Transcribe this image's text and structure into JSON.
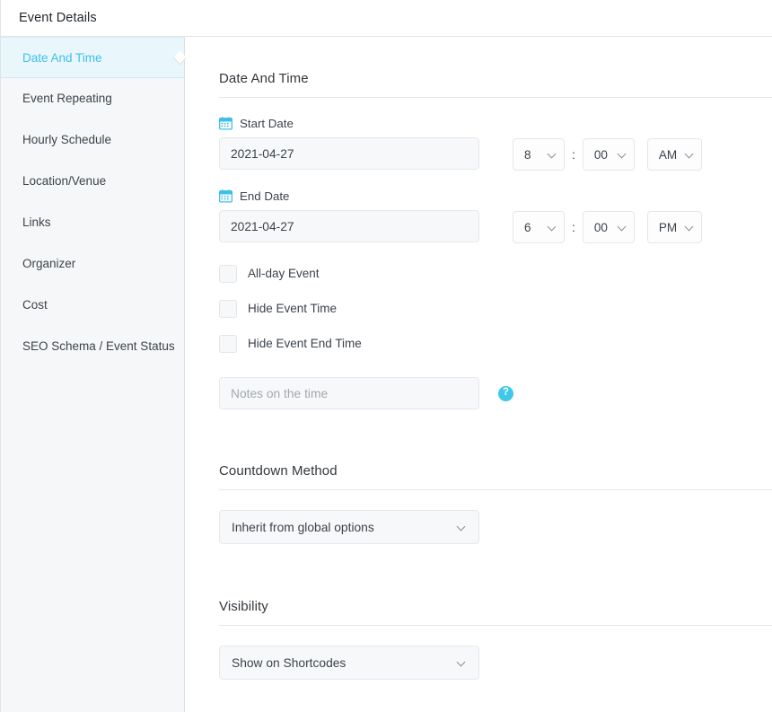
{
  "window": {
    "title": "Event Details"
  },
  "sidebar": {
    "items": [
      {
        "label": "Date And Time",
        "active": true
      },
      {
        "label": "Event Repeating",
        "active": false
      },
      {
        "label": "Hourly Schedule",
        "active": false
      },
      {
        "label": "Location/Venue",
        "active": false
      },
      {
        "label": "Links",
        "active": false
      },
      {
        "label": "Organizer",
        "active": false
      },
      {
        "label": "Cost",
        "active": false
      },
      {
        "label": "SEO Schema / Event Status",
        "active": false
      }
    ]
  },
  "main": {
    "sections": [
      {
        "key": "date_and_time",
        "title": "Date And Time"
      },
      {
        "key": "countdown_method",
        "title": "Countdown Method"
      },
      {
        "key": "visibility",
        "title": "Visibility"
      }
    ],
    "date_and_time": {
      "start": {
        "label": "Start Date",
        "icon": "calendar-icon",
        "value": "2021-04-27",
        "hour": "8",
        "minute": "00",
        "meridiem": "AM",
        "separator": ":"
      },
      "end": {
        "label": "End Date",
        "icon": "calendar-icon",
        "value": "2021-04-27",
        "hour": "6",
        "minute": "00",
        "meridiem": "PM",
        "separator": ":"
      },
      "checkboxes": [
        {
          "label": "All-day Event",
          "checked": false
        },
        {
          "label": "Hide Event Time",
          "checked": false
        },
        {
          "label": "Hide Event End Time",
          "checked": false
        }
      ],
      "notes": {
        "value": "",
        "placeholder": "Notes on the time",
        "help_icon": "question-mark-icon",
        "help_glyph": "?"
      }
    },
    "countdown_method": {
      "selected": "Inherit from global options"
    },
    "visibility": {
      "selected": "Show on Shortcodes"
    }
  },
  "colors": {
    "accent": "#3fbfe8",
    "accent_bg": "#e9f7fd",
    "help_icon": "#3ec9e8",
    "text": "#3c434a",
    "sidebar_bg": "#f6f7f8",
    "input_bg": "#f7f8fa",
    "border": "#e4e6e8"
  }
}
